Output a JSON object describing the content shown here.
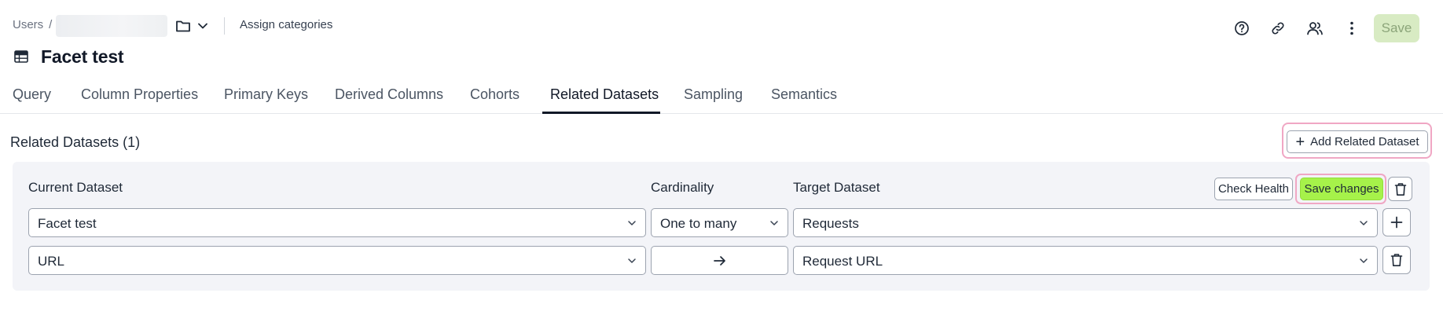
{
  "header": {
    "breadcrumb_root": "Users",
    "breadcrumb_separator": "/",
    "assign_label": "Assign categories",
    "save_label": "Save",
    "title": "Facet test"
  },
  "tabs": [
    {
      "label": "Query"
    },
    {
      "label": "Column Properties"
    },
    {
      "label": "Primary Keys"
    },
    {
      "label": "Derived Columns"
    },
    {
      "label": "Cohorts"
    },
    {
      "label": "Related Datasets",
      "active": true
    },
    {
      "label": "Sampling"
    },
    {
      "label": "Semantics"
    }
  ],
  "section": {
    "title": "Related Datasets (1)",
    "add_label": "Add Related Dataset"
  },
  "relation": {
    "current_label": "Current Dataset",
    "cardinality_label": "Cardinality",
    "target_label": "Target Dataset",
    "check_health_label": "Check Health",
    "save_changes_label": "Save changes",
    "rows": [
      {
        "current": "Facet test",
        "cardinality": "One to many",
        "target": "Requests"
      },
      {
        "current": "URL",
        "cardinality_icon": "arrow-right-icon",
        "target": "Request URL"
      }
    ]
  },
  "colors": {
    "accent_green": "#a6f24a",
    "highlight_pink": "#f0a7c4",
    "save_disabled_bg": "#d8ebc3",
    "panel_bg": "#f3f4f8"
  },
  "icons": [
    "folder-icon",
    "chevron-down-icon",
    "help-icon",
    "link-icon",
    "users-icon",
    "more-vertical-icon",
    "table-icon",
    "plus-icon",
    "trash-icon",
    "arrow-right-icon"
  ]
}
